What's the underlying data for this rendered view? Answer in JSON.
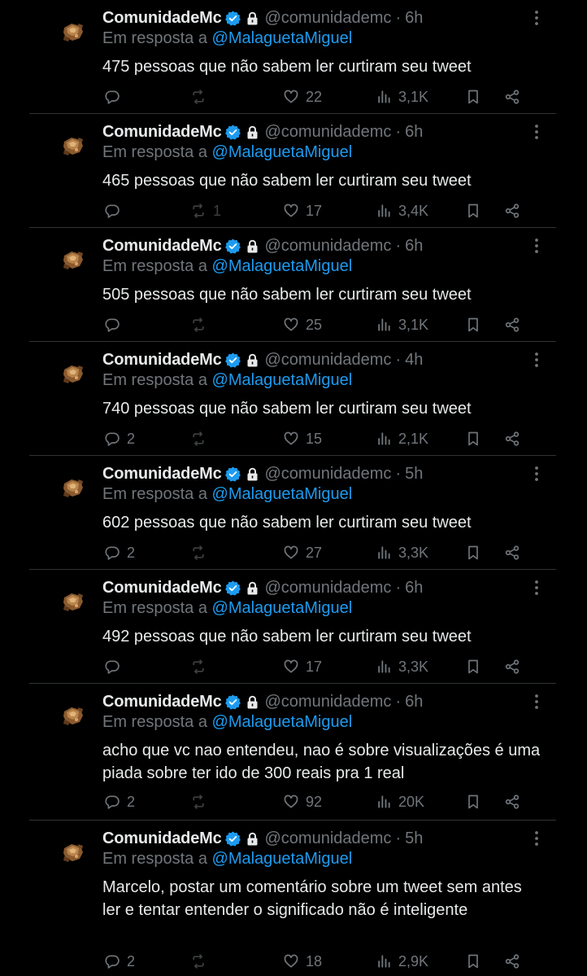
{
  "colors": {
    "background": "#000000",
    "text": "#e7e9ea",
    "muted": "#71767b",
    "accent": "#1d9bf0",
    "divider": "#2f3336"
  },
  "icons": {
    "verified": "verified-badge-icon",
    "lock": "lock-icon",
    "more": "more-options-icon",
    "reply": "reply-icon",
    "retweet": "retweet-icon",
    "like": "heart-icon",
    "views": "views-icon",
    "bookmark": "bookmark-icon",
    "share": "share-icon"
  },
  "tweets": [
    {
      "name": "ComunidadeMc",
      "handle": "@comunidademc",
      "sep": "·",
      "time": "6h",
      "reply_prefix": "Em resposta a",
      "reply_to": "@MalaguetaMiguel",
      "text": "475 pessoas que não sabem ler curtiram seu tweet",
      "replies": "",
      "retweets": "",
      "likes": "22",
      "views": "3,1K"
    },
    {
      "name": "ComunidadeMc",
      "handle": "@comunidademc",
      "sep": "·",
      "time": "6h",
      "reply_prefix": "Em resposta a",
      "reply_to": "@MalaguetaMiguel",
      "text": "465 pessoas que não sabem ler curtiram seu tweet",
      "replies": "",
      "retweets": "1",
      "likes": "17",
      "views": "3,4K"
    },
    {
      "name": "ComunidadeMc",
      "handle": "@comunidademc",
      "sep": "·",
      "time": "6h",
      "reply_prefix": "Em resposta a",
      "reply_to": "@MalaguetaMiguel",
      "text": "505 pessoas que não sabem ler curtiram seu tweet",
      "replies": "",
      "retweets": "",
      "likes": "25",
      "views": "3,1K"
    },
    {
      "name": "ComunidadeMc",
      "handle": "@comunidademc",
      "sep": "·",
      "time": "4h",
      "reply_prefix": "Em resposta a",
      "reply_to": "@MalaguetaMiguel",
      "text": "740 pessoas que não sabem ler curtiram seu tweet",
      "replies": "2",
      "retweets": "",
      "likes": "15",
      "views": "2,1K"
    },
    {
      "name": "ComunidadeMc",
      "handle": "@comunidademc",
      "sep": "·",
      "time": "5h",
      "reply_prefix": "Em resposta a",
      "reply_to": "@MalaguetaMiguel",
      "text": "602 pessoas que não sabem ler curtiram seu tweet",
      "replies": "2",
      "retweets": "",
      "likes": "27",
      "views": "3,3K"
    },
    {
      "name": "ComunidadeMc",
      "handle": "@comunidademc",
      "sep": "·",
      "time": "6h",
      "reply_prefix": "Em resposta a",
      "reply_to": "@MalaguetaMiguel",
      "text": "492 pessoas que não sabem ler curtiram seu tweet",
      "replies": "",
      "retweets": "",
      "likes": "17",
      "views": "3,3K"
    },
    {
      "name": "ComunidadeMc",
      "handle": "@comunidademc",
      "sep": "·",
      "time": "6h",
      "reply_prefix": "Em resposta a",
      "reply_to": "@MalaguetaMiguel",
      "text": "acho que vc nao entendeu, nao é sobre visualizações é uma piada sobre ter ido de 300 reais pra 1 real",
      "replies": "2",
      "retweets": "",
      "likes": "92",
      "views": "20K"
    },
    {
      "name": "ComunidadeMc",
      "handle": "@comunidademc",
      "sep": "·",
      "time": "5h",
      "reply_prefix": "Em resposta a",
      "reply_to": "@MalaguetaMiguel",
      "text": "Marcelo, postar um comentário sobre um tweet sem antes ler e tentar entender o significado não é inteligente",
      "replies": "2",
      "retweets": "",
      "likes": "18",
      "views": "2,9K"
    }
  ]
}
